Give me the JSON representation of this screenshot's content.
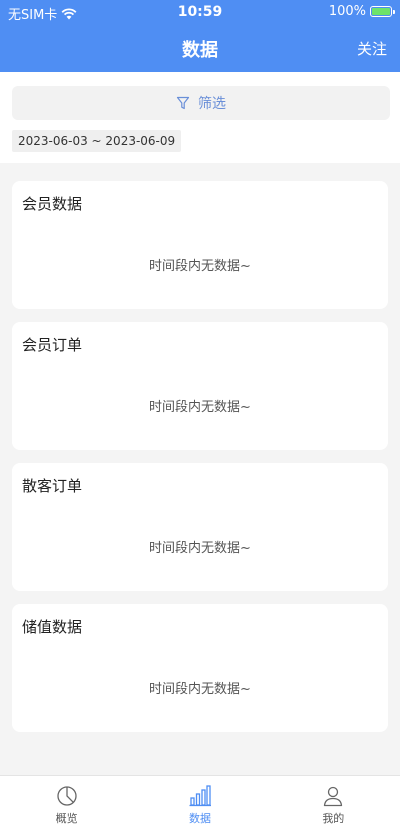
{
  "status_bar": {
    "carrier": "无SIM卡",
    "time": "10:59",
    "battery": "100%"
  },
  "navbar": {
    "title": "数据",
    "action": "关注"
  },
  "filter": {
    "label": "筛选",
    "date_range": "2023-06-03 ~ 2023-06-09"
  },
  "cards": [
    {
      "title": "会员数据",
      "empty": "时间段内无数据~"
    },
    {
      "title": "会员订单",
      "empty": "时间段内无数据~"
    },
    {
      "title": "散客订单",
      "empty": "时间段内无数据~"
    },
    {
      "title": "储值数据",
      "empty": "时间段内无数据~"
    }
  ],
  "tabbar": {
    "items": [
      {
        "label": "概览",
        "icon": "pie-chart-icon"
      },
      {
        "label": "数据",
        "icon": "bar-chart-icon",
        "active": true
      },
      {
        "label": "我的",
        "icon": "user-icon"
      }
    ]
  },
  "colors": {
    "primary": "#4f8ef3",
    "battery": "#6ee36b"
  }
}
